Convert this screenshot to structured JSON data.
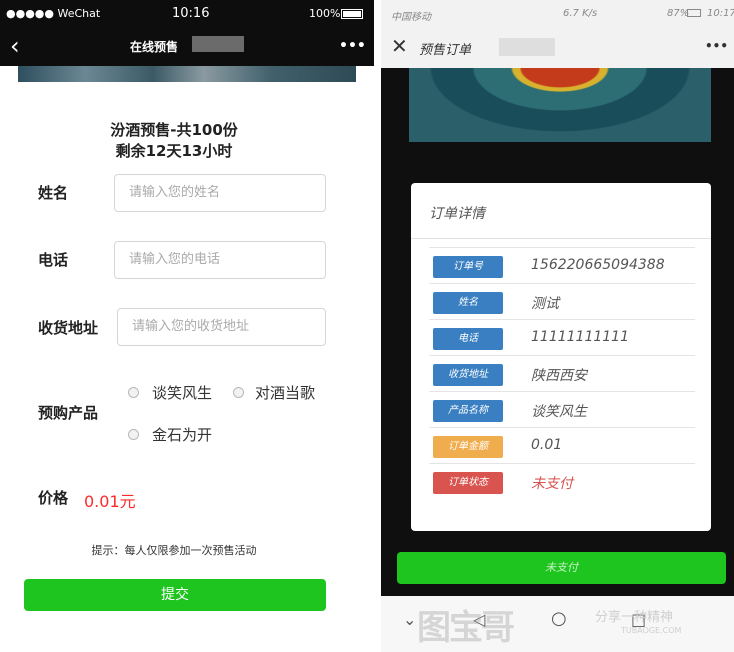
{
  "left": {
    "status": {
      "carrier": "●●●●● WeChat",
      "time": "10:16",
      "battery": "100%"
    },
    "nav": {
      "title": "在线预售",
      "more": "•••"
    },
    "headline": {
      "line1": "汾酒预售-共100份",
      "line2": "剩余12天13小时"
    },
    "form": {
      "name_label": "姓名",
      "name_placeholder": "请输入您的姓名",
      "phone_label": "电话",
      "phone_placeholder": "请输入您的电话",
      "address_label": "收货地址",
      "address_placeholder": "请输入您的收货地址",
      "product_label": "预购产品",
      "options": [
        "谈笑风生",
        "对酒当歌",
        "金石为开"
      ],
      "price_label": "价格",
      "price_value": "0.01元",
      "tip": "提示：每人仅限参加一次预售活动",
      "submit": "提交"
    }
  },
  "right": {
    "status": {
      "carrier": "中国移动",
      "speed": "6.7 K/s",
      "battery": "87%",
      "time": "10:17"
    },
    "nav": {
      "title": "预售订单",
      "more": "•••"
    },
    "card_title": "订单详情",
    "rows": [
      {
        "label": "订单号",
        "value": "156220665094388",
        "color": "#3a7fc1"
      },
      {
        "label": "姓名",
        "value": "测试",
        "color": "#3a7fc1"
      },
      {
        "label": "电话",
        "value": "11111111111",
        "color": "#3a7fc1"
      },
      {
        "label": "收货地址",
        "value": "陕西西安",
        "color": "#3a7fc1"
      },
      {
        "label": "产品名称",
        "value": "谈笑风生",
        "color": "#3a7fc1"
      },
      {
        "label": "订单金额",
        "value": "0.01",
        "color": "#f0ad4e"
      },
      {
        "label": "订单状态",
        "value": "未支付",
        "color": "#d9534f"
      }
    ],
    "pay_button": "未支付",
    "watermark": {
      "text": "分享一种精神",
      "site": "TUBAOGE.COM"
    }
  },
  "colors": {
    "accent_green": "#1ec51e",
    "price_red": "#ff2a2a",
    "status_red": "#d9534f"
  }
}
